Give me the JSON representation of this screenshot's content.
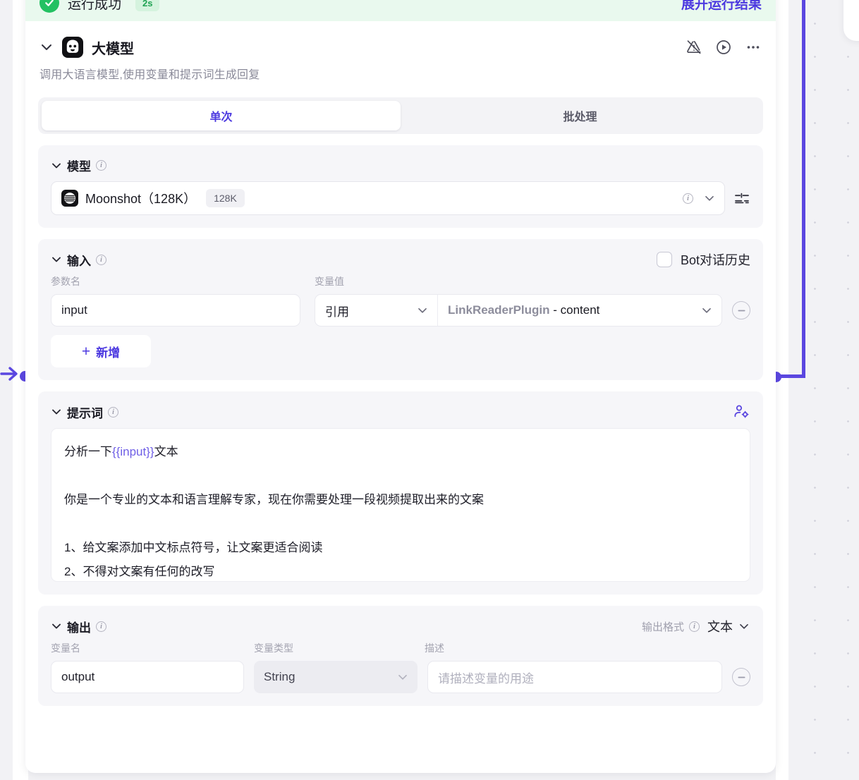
{
  "run_status": {
    "label": "运行成功",
    "duration": "2s",
    "expand_label": "展开运行结果",
    "check_icon": "check-circle-icon",
    "banner_color": "#e9f9ee",
    "accent_color": "#4d3ae0",
    "success_color": "#23c162"
  },
  "node": {
    "title": "大模型",
    "description": "调用大语言模型,使用变量和提示词生成回复",
    "collapse_icon": "chevron-down-icon",
    "avatar_icon": "llm-node-avatar-icon",
    "actions": [
      {
        "name": "warning-off-icon"
      },
      {
        "name": "run-node-icon"
      },
      {
        "name": "more-options-icon"
      }
    ]
  },
  "tabs": [
    {
      "label": "单次",
      "active": true
    },
    {
      "label": "批处理",
      "active": false
    }
  ],
  "model_section": {
    "title": "模型",
    "info_icon": "info-icon",
    "model_name": "Moonshot（128K）",
    "context_badge": "128K",
    "logo_icon": "moonshot-logo-icon",
    "row_info_icon": "info-icon",
    "row_chevron_icon": "chevron-down-icon",
    "settings_icon": "model-settings-sliders-icon"
  },
  "input_section": {
    "title": "输入",
    "info_icon": "info-icon",
    "bot_history_label": "Bot对话历史",
    "bot_history_checked": false,
    "columns": {
      "param_name": "参数名",
      "variable_value": "变量值"
    },
    "rows": [
      {
        "param_name": "input",
        "ref_type": "引用",
        "ref_plugin": "LinkReaderPlugin",
        "ref_separator": " - ",
        "ref_field": "content",
        "remove_icon": "minus-circle-icon"
      }
    ],
    "add_label": "新增",
    "add_icon": "plus-icon"
  },
  "prompt_section": {
    "title": "提示词",
    "info_icon": "info-icon",
    "persona_icon": "persona-settings-icon",
    "text_line1_before": "分析一下",
    "text_variable": "{{input}}",
    "text_line1_after": "文本",
    "text_rest": "\n\n你是一个专业的文本和语言理解专家，现在你需要处理一段视频提取出来的文案\n\n1、给文案添加中文标点符号，让文案更适合阅读\n2、不得对文案有任何的改写"
  },
  "output_section": {
    "title": "输出",
    "info_icon": "info-icon",
    "format_label": "输出格式",
    "format_info_icon": "info-icon",
    "format_value": "文本",
    "format_chevron_icon": "chevron-down-icon",
    "columns": {
      "variable_name": "变量名",
      "variable_type": "变量类型",
      "description": "描述"
    },
    "rows": [
      {
        "variable_name": "output",
        "variable_type": "String",
        "description_placeholder": "请描述变量的用途",
        "remove_icon": "minus-circle-icon",
        "type_chevron_icon": "chevron-down-icon"
      }
    ]
  },
  "canvas": {
    "input_port_icon": "input-arrow-icon",
    "input_port_dot": "connector-dot-left",
    "output_port_dot": "connector-dot-right",
    "edge_color": "#5b47e0"
  }
}
